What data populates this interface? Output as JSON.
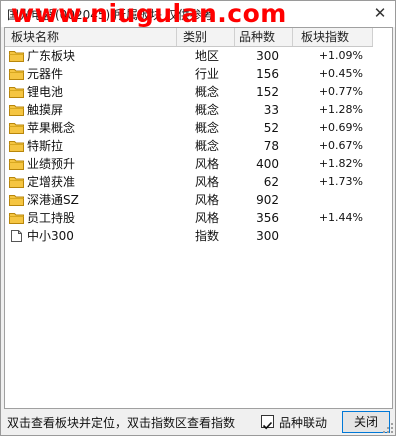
{
  "window": {
    "title": "国光电器(002045) 所属板块 仅供参考",
    "watermark": "www.niugulan.com",
    "close_glyph": "✕"
  },
  "table": {
    "headers": {
      "name": "板块名称",
      "type": "类别",
      "count": "品种数",
      "index": "板块指数"
    },
    "rows": [
      {
        "name": "广东板块",
        "type": "地区",
        "count": "300",
        "index": "+1.09%",
        "icon": "folder-icon"
      },
      {
        "name": "元器件",
        "type": "行业",
        "count": "156",
        "index": "+0.45%",
        "icon": "folder-icon"
      },
      {
        "name": "锂电池",
        "type": "概念",
        "count": "152",
        "index": "+0.77%",
        "icon": "folder-icon"
      },
      {
        "name": "触摸屏",
        "type": "概念",
        "count": "33",
        "index": "+1.28%",
        "icon": "folder-icon"
      },
      {
        "name": "苹果概念",
        "type": "概念",
        "count": "52",
        "index": "+0.69%",
        "icon": "folder-icon"
      },
      {
        "name": "特斯拉",
        "type": "概念",
        "count": "78",
        "index": "+0.67%",
        "icon": "folder-icon"
      },
      {
        "name": "业绩预升",
        "type": "风格",
        "count": "400",
        "index": "+1.82%",
        "icon": "folder-icon"
      },
      {
        "name": "定增获准",
        "type": "风格",
        "count": "62",
        "index": "+1.73%",
        "icon": "folder-icon"
      },
      {
        "name": "深港通SZ",
        "type": "风格",
        "count": "902",
        "index": "",
        "icon": "folder-icon"
      },
      {
        "name": "员工持股",
        "type": "风格",
        "count": "356",
        "index": "+1.44%",
        "icon": "folder-icon"
      },
      {
        "name": "中小300",
        "type": "指数",
        "count": "300",
        "index": "",
        "icon": "document-icon"
      }
    ]
  },
  "status": {
    "hint": "双击查看板块并定位，双击指数区查看指数",
    "checkbox_label": "品种联动",
    "checkbox_checked": true,
    "close_button": "关闭"
  },
  "colors": {
    "watermark": "#ff0000",
    "folder": "#f5c542",
    "button_border": "#0078d7"
  }
}
